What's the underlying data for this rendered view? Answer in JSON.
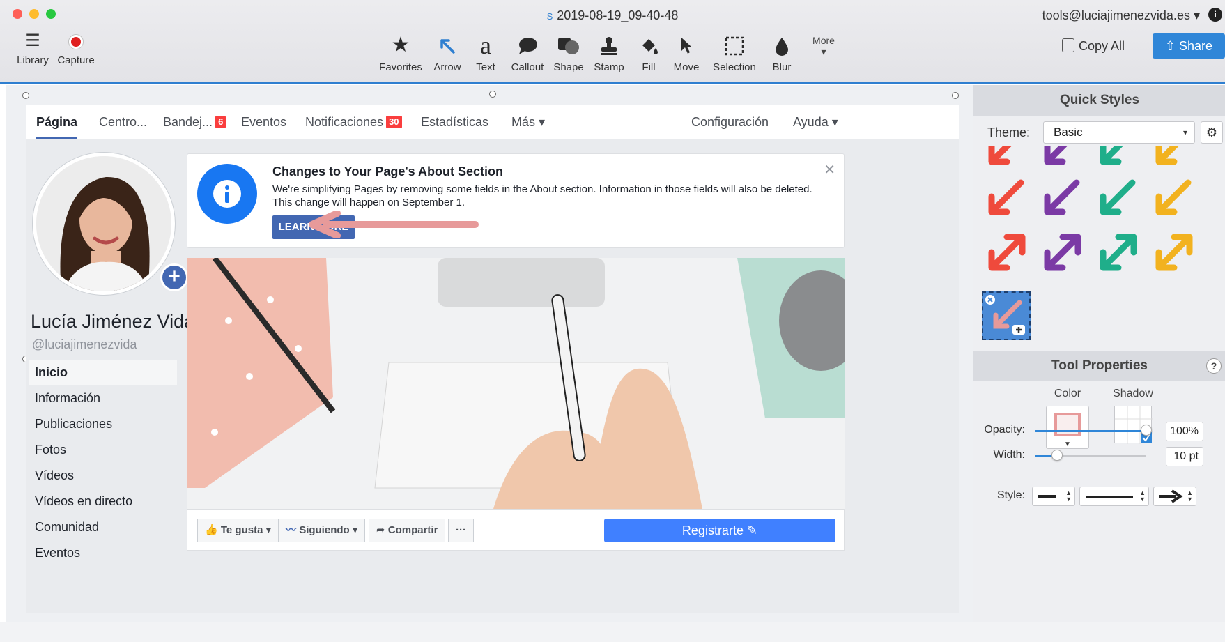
{
  "window": {
    "title": "2019-08-19_09-40-48",
    "account": "tools@luciajimenezvida.es"
  },
  "toolbar": {
    "left": [
      {
        "label": "Library",
        "icon": "hamburger-icon"
      },
      {
        "label": "Capture",
        "icon": "record-icon"
      }
    ],
    "tools": [
      {
        "label": "Favorites",
        "icon": "star-icon"
      },
      {
        "label": "Arrow",
        "icon": "arrow-icon"
      },
      {
        "label": "Text",
        "icon": "text-icon"
      },
      {
        "label": "Callout",
        "icon": "callout-icon"
      },
      {
        "label": "Shape",
        "icon": "shape-icon"
      },
      {
        "label": "Stamp",
        "icon": "stamp-icon"
      },
      {
        "label": "Fill",
        "icon": "fill-icon"
      },
      {
        "label": "Move",
        "icon": "move-icon"
      },
      {
        "label": "Selection",
        "icon": "selection-icon"
      },
      {
        "label": "Blur",
        "icon": "blur-icon"
      }
    ],
    "more_label": "More",
    "copy_all": "Copy All",
    "share": "Share"
  },
  "facebook": {
    "nav": {
      "tabs": [
        {
          "label": "Página",
          "badge": ""
        },
        {
          "label": "Centro...",
          "badge": ""
        },
        {
          "label": "Bandej...",
          "badge": "6"
        },
        {
          "label": "Eventos",
          "badge": ""
        },
        {
          "label": "Notificaciones",
          "badge": "30"
        },
        {
          "label": "Estadísticas",
          "badge": ""
        },
        {
          "label": "Más ▾",
          "badge": ""
        }
      ],
      "right": [
        "Configuración",
        "Ayuda ▾"
      ]
    },
    "profile": {
      "name": "Lucía Jiménez Vida",
      "handle": "@luciajimenezvida"
    },
    "side_menu": [
      "Inicio",
      "Información",
      "Publicaciones",
      "Fotos",
      "Vídeos",
      "Vídeos en directo",
      "Comunidad",
      "Eventos"
    ],
    "notice": {
      "title": "Changes to Your Page's About Section",
      "body": "We're simplifying Pages by removing some fields in the About section. Information in those fields will also be deleted. This change will happen on September 1.",
      "button": "LEARN MORE"
    },
    "actions": {
      "like": "Te gusta ▾",
      "following": "Siguiendo ▾",
      "share": "Compartir",
      "more": "···",
      "signup": "Registrarte"
    }
  },
  "panel": {
    "quick_styles": "Quick Styles",
    "theme_label": "Theme:",
    "theme_value": "Basic",
    "arrow_colors": [
      "#ef4a3c",
      "#7b3aa5",
      "#1fae8a",
      "#f2b21f"
    ],
    "tool_properties": "Tool Properties",
    "color_label": "Color",
    "shadow_label": "Shadow",
    "opacity_label": "Opacity:",
    "opacity_value": "100%",
    "opacity_level": 1.0,
    "width_label": "Width:",
    "width_value": "10 pt",
    "width_level": 0.2,
    "style_label": "Style:",
    "selected_color": "#e79a9a"
  }
}
